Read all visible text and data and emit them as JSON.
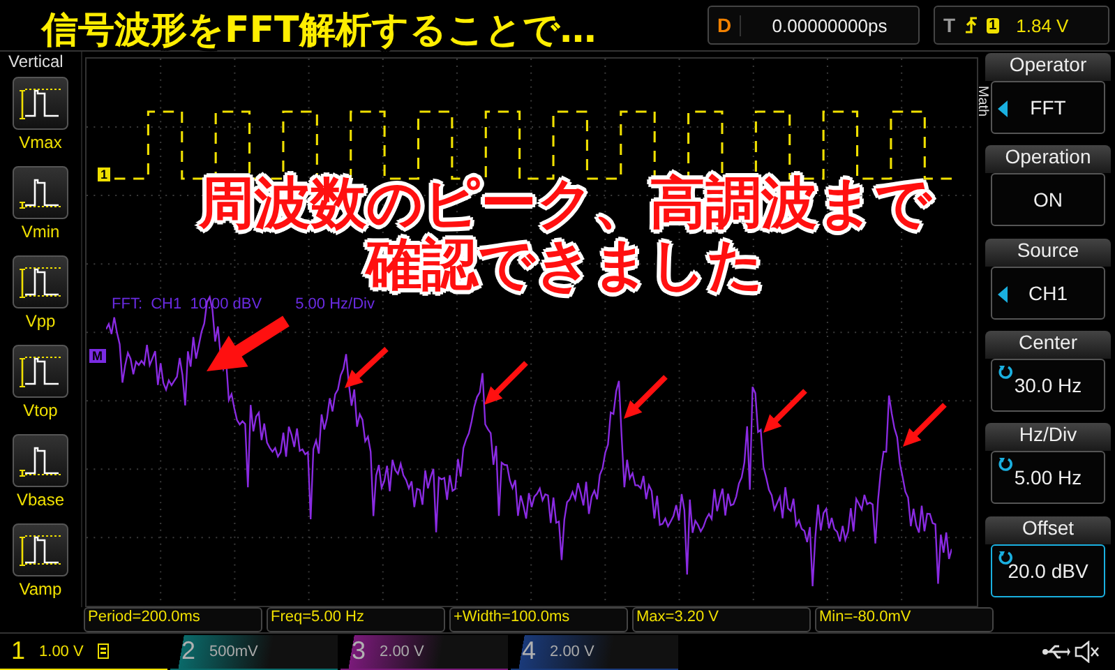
{
  "headline": "信号波形をFFT解析することで…",
  "annotation": {
    "lines": [
      "周波数のピーク、高調波まで",
      "確認できました"
    ]
  },
  "top_bar": {
    "delay_label": "D",
    "delay": "0.00000000ps",
    "trigger_label": "T",
    "trigger_source": "1",
    "trigger_level": "1.84 V"
  },
  "left_panel": {
    "title": "Vertical",
    "items": [
      {
        "label": "Vmax",
        "kind": "max"
      },
      {
        "label": "Vmin",
        "kind": "min"
      },
      {
        "label": "Vpp",
        "kind": "pp"
      },
      {
        "label": "Vtop",
        "kind": "top"
      },
      {
        "label": "Vbase",
        "kind": "base"
      },
      {
        "label": "Vamp",
        "kind": "amp"
      }
    ]
  },
  "plot": {
    "channel_marker": "1",
    "math_marker": "M",
    "fft_label": "FFT:  CH1  10.00 dBV",
    "fft_scale": "5.00 Hz/Div"
  },
  "right_panel": {
    "tab": "Math",
    "items": [
      {
        "label": "Operator",
        "value": "FFT",
        "kind": "select",
        "selected": false
      },
      {
        "label": "Operation",
        "value": "ON",
        "kind": "plain",
        "selected": false
      },
      {
        "label": "Source",
        "value": "CH1",
        "kind": "select",
        "selected": false
      },
      {
        "label": "Center",
        "value": "30.0 Hz",
        "kind": "knob",
        "selected": false
      },
      {
        "label": "Hz/Div",
        "value": "5.00 Hz",
        "kind": "knob",
        "selected": false
      },
      {
        "label": "Offset",
        "value": "20.0 dBV",
        "kind": "knob",
        "selected": true
      }
    ]
  },
  "measurements": [
    "Period=200.0ms",
    "Freq=5.00 Hz",
    "+Width=100.0ms",
    "Max=3.20 V",
    "Min=-80.0mV"
  ],
  "channels": [
    {
      "number": "1",
      "scale": "1.00 V",
      "on": true,
      "color": "#f0e000"
    },
    {
      "number": "2",
      "scale": "500mV",
      "on": false,
      "color": "#0a6a6a"
    },
    {
      "number": "3",
      "scale": "2.00 V",
      "on": false,
      "color": "#7a1a7a"
    },
    {
      "number": "4",
      "scale": "2.00 V",
      "on": false,
      "color": "#1a3a7a"
    }
  ]
}
